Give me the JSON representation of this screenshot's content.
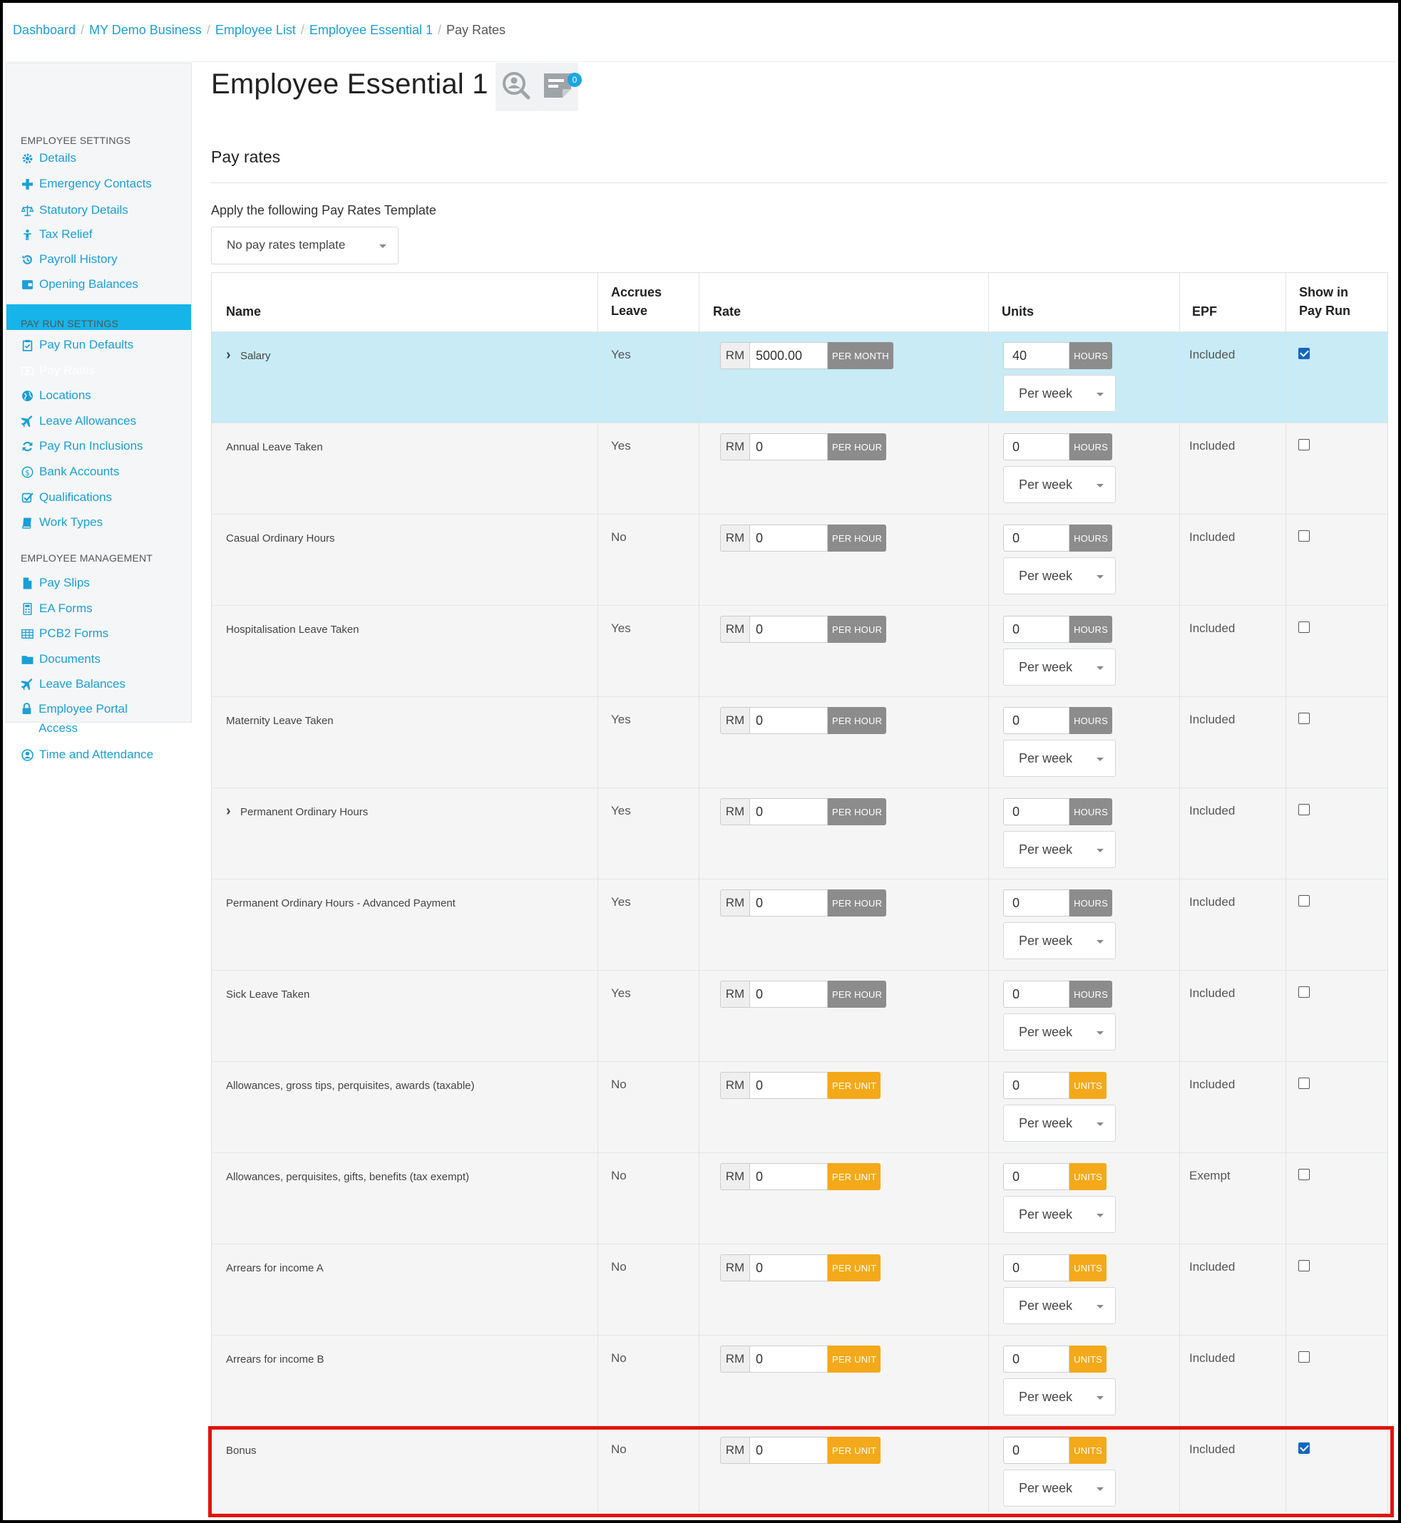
{
  "breadcrumb": {
    "items": [
      "Dashboard",
      "MY Demo Business",
      "Employee List",
      "Employee Essential 1"
    ],
    "current": "Pay Rates",
    "separator": "/"
  },
  "sidebar": {
    "sections": [
      {
        "heading": "EMPLOYEE SETTINGS"
      },
      {
        "heading": "PAY RUN SETTINGS"
      },
      {
        "heading": "EMPLOYEE MANAGEMENT"
      }
    ],
    "items": [
      {
        "label": "Details",
        "icon": "gear-icon"
      },
      {
        "label": "Emergency Contacts",
        "icon": "plus-icon"
      },
      {
        "label": "Statutory Details",
        "icon": "scales-icon"
      },
      {
        "label": "Tax Relief",
        "icon": "person-icon"
      },
      {
        "label": "Payroll History",
        "icon": "history-icon"
      },
      {
        "label": "Opening Balances",
        "icon": "wallet-icon"
      },
      {
        "label": "Pay Run Defaults",
        "icon": "clipboard-icon"
      },
      {
        "label": "Pay Rates",
        "icon": "money-icon",
        "active": true
      },
      {
        "label": "Locations",
        "icon": "globe-icon"
      },
      {
        "label": "Leave Allowances",
        "icon": "plane-icon"
      },
      {
        "label": "Pay Run Inclusions",
        "icon": "refresh-icon"
      },
      {
        "label": "Bank Accounts",
        "icon": "dollar-circle-icon"
      },
      {
        "label": "Qualifications",
        "icon": "check-square-icon"
      },
      {
        "label": "Work Types",
        "icon": "book-icon"
      },
      {
        "label": "Pay Slips",
        "icon": "file-icon"
      },
      {
        "label": "EA Forms",
        "icon": "calculator-icon"
      },
      {
        "label": "PCB2 Forms",
        "icon": "table-icon"
      },
      {
        "label": "Documents",
        "icon": "folder-icon"
      },
      {
        "label": "Leave Balances",
        "icon": "plane-icon"
      },
      {
        "label": "Employee Portal Access",
        "icon": "lock-icon"
      },
      {
        "label": "Time and Attendance",
        "icon": "user-circle-icon"
      }
    ]
  },
  "header": {
    "employee_name": "Employee Essential 1",
    "notes_badge_count": "0"
  },
  "section": {
    "title": "Pay rates",
    "template_label": "Apply the following Pay Rates Template",
    "template_value": "No pay rates template"
  },
  "table": {
    "columns": {
      "name": "Name",
      "accrues_leave": "Accrues Leave",
      "rate": "Rate",
      "units": "Units",
      "epf": "EPF",
      "show_in_pay_run": "Show in Pay Run"
    },
    "currency": "RM",
    "rows": [
      {
        "name": "Salary",
        "expandable": true,
        "accrues": "Yes",
        "rate": "5000.00",
        "rate_tag": "PER MONTH",
        "units": "40",
        "units_tag": "HOURS",
        "frequency": "Per week",
        "epf": "Included",
        "show": true,
        "highlight": true
      },
      {
        "name": "Annual Leave Taken",
        "expandable": false,
        "accrues": "Yes",
        "rate": "0",
        "rate_tag": "PER HOUR",
        "units": "0",
        "units_tag": "HOURS",
        "frequency": "Per week",
        "epf": "Included",
        "show": false
      },
      {
        "name": "Casual Ordinary Hours",
        "expandable": false,
        "accrues": "No",
        "rate": "0",
        "rate_tag": "PER HOUR",
        "units": "0",
        "units_tag": "HOURS",
        "frequency": "Per week",
        "epf": "Included",
        "show": false
      },
      {
        "name": "Hospitalisation Leave Taken",
        "expandable": false,
        "accrues": "Yes",
        "rate": "0",
        "rate_tag": "PER HOUR",
        "units": "0",
        "units_tag": "HOURS",
        "frequency": "Per week",
        "epf": "Included",
        "show": false
      },
      {
        "name": "Maternity Leave Taken",
        "expandable": false,
        "accrues": "Yes",
        "rate": "0",
        "rate_tag": "PER HOUR",
        "units": "0",
        "units_tag": "HOURS",
        "frequency": "Per week",
        "epf": "Included",
        "show": false
      },
      {
        "name": "Permanent Ordinary Hours",
        "expandable": true,
        "accrues": "Yes",
        "rate": "0",
        "rate_tag": "PER HOUR",
        "units": "0",
        "units_tag": "HOURS",
        "frequency": "Per week",
        "epf": "Included",
        "show": false
      },
      {
        "name": "Permanent Ordinary Hours - Advanced Payment",
        "expandable": false,
        "accrues": "Yes",
        "rate": "0",
        "rate_tag": "PER HOUR",
        "units": "0",
        "units_tag": "HOURS",
        "frequency": "Per week",
        "epf": "Included",
        "show": false
      },
      {
        "name": "Sick Leave Taken",
        "expandable": false,
        "accrues": "Yes",
        "rate": "0",
        "rate_tag": "PER HOUR",
        "units": "0",
        "units_tag": "HOURS",
        "frequency": "Per week",
        "epf": "Included",
        "show": false
      },
      {
        "name": "Allowances, gross tips, perquisites, awards (taxable)",
        "expandable": false,
        "accrues": "No",
        "rate": "0",
        "rate_tag": "PER UNIT",
        "units": "0",
        "units_tag": "UNITS",
        "frequency": "Per week",
        "epf": "Included",
        "show": false
      },
      {
        "name": "Allowances, perquisites, gifts, benefits (tax exempt)",
        "expandable": false,
        "accrues": "No",
        "rate": "0",
        "rate_tag": "PER UNIT",
        "units": "0",
        "units_tag": "UNITS",
        "frequency": "Per week",
        "epf": "Exempt",
        "show": false
      },
      {
        "name": "Arrears for income A",
        "expandable": false,
        "accrues": "No",
        "rate": "0",
        "rate_tag": "PER UNIT",
        "units": "0",
        "units_tag": "UNITS",
        "frequency": "Per week",
        "epf": "Included",
        "show": false
      },
      {
        "name": "Arrears for income B",
        "expandable": false,
        "accrues": "No",
        "rate": "0",
        "rate_tag": "PER UNIT",
        "units": "0",
        "units_tag": "UNITS",
        "frequency": "Per week",
        "epf": "Included",
        "show": false
      },
      {
        "name": "Bonus",
        "expandable": false,
        "accrues": "No",
        "rate": "0",
        "rate_tag": "PER UNIT",
        "units": "0",
        "units_tag": "UNITS",
        "frequency": "Per week",
        "epf": "Included",
        "show": true,
        "outlined": true
      }
    ]
  },
  "colors": {
    "link": "#1a9fd6",
    "active_nav": "#16b4e9",
    "highlight_row": "#c8ebf6",
    "per_hour_tag": "#8c8c8c",
    "per_unit_tag": "#f3a91a",
    "annotation_box": "#e0140c"
  }
}
